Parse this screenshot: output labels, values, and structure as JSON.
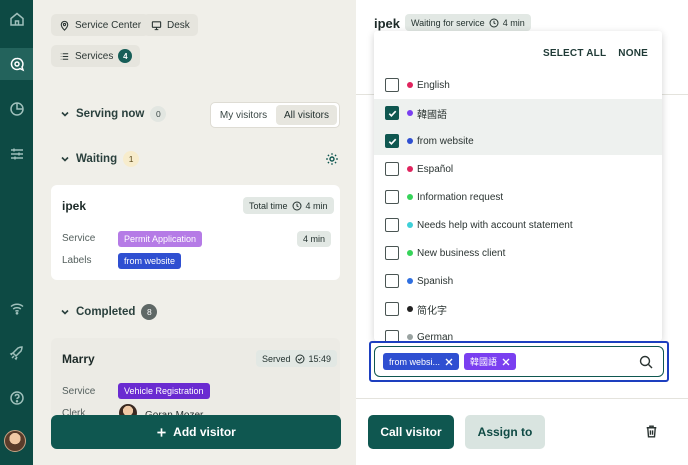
{
  "rail": {
    "items": [
      "home-icon",
      "chat-search-icon",
      "pie-chart-icon",
      "sliders-icon",
      "wifi-icon",
      "rocket-icon",
      "help-icon"
    ]
  },
  "filters": {
    "service_center_label": "Service Center",
    "desk_label": "Desk",
    "services_label": "Services",
    "services_count": "4"
  },
  "serving_now": {
    "title": "Serving now",
    "count": "0",
    "toggle": [
      "My visitors",
      "All visitors"
    ],
    "active_toggle": "All visitors"
  },
  "waiting": {
    "title": "Waiting",
    "count": "1",
    "visitor": {
      "name": "ipek",
      "total_time_label": "Total time",
      "total_time": "4 min",
      "service_label": "Service",
      "service": "Permit Application",
      "service_time": "4 min",
      "labels_label": "Labels",
      "label": "from website"
    }
  },
  "completed": {
    "title": "Completed",
    "count": "8",
    "visitor": {
      "name": "Marry",
      "served_label": "Served",
      "served_time": "15:49",
      "service_label": "Service",
      "service": "Vehicle Registration",
      "clerk_label": "Clerk",
      "clerk": "Goran Mozer"
    }
  },
  "add_visitor_label": "Add visitor",
  "detail": {
    "name": "ipek",
    "status": "Waiting for service",
    "status_time": "4 min",
    "call_label": "Call visitor",
    "assign_label": "Assign to"
  },
  "label_dropdown": {
    "select_all": "SELECT ALL",
    "none": "NONE",
    "options": [
      {
        "label": "English",
        "color": "#e0245e",
        "checked": false
      },
      {
        "label": "韓國語",
        "color": "#7a3ff0",
        "checked": true
      },
      {
        "label": "from website",
        "color": "#2f4fd1",
        "checked": true
      },
      {
        "label": "Español",
        "color": "#e0245e",
        "checked": false
      },
      {
        "label": "Information request",
        "color": "#37d45a",
        "checked": false
      },
      {
        "label": "Needs help with account statement",
        "color": "#3ed0d8",
        "checked": false
      },
      {
        "label": "New business client",
        "color": "#37d45a",
        "checked": false
      },
      {
        "label": "Spanish",
        "color": "#2f6fe0",
        "checked": false
      },
      {
        "label": "简化字",
        "color": "#222222",
        "checked": false
      },
      {
        "label": "German",
        "color": "#9aa3a1",
        "checked": false
      }
    ],
    "selected_chips": [
      "from websi...",
      "韓國語"
    ]
  },
  "colors": {
    "primary": "#0f5750",
    "permit_tag": "#b57be6",
    "website_tag": "#2f4fd1",
    "vehicle_tag": "#6a2bd1"
  }
}
